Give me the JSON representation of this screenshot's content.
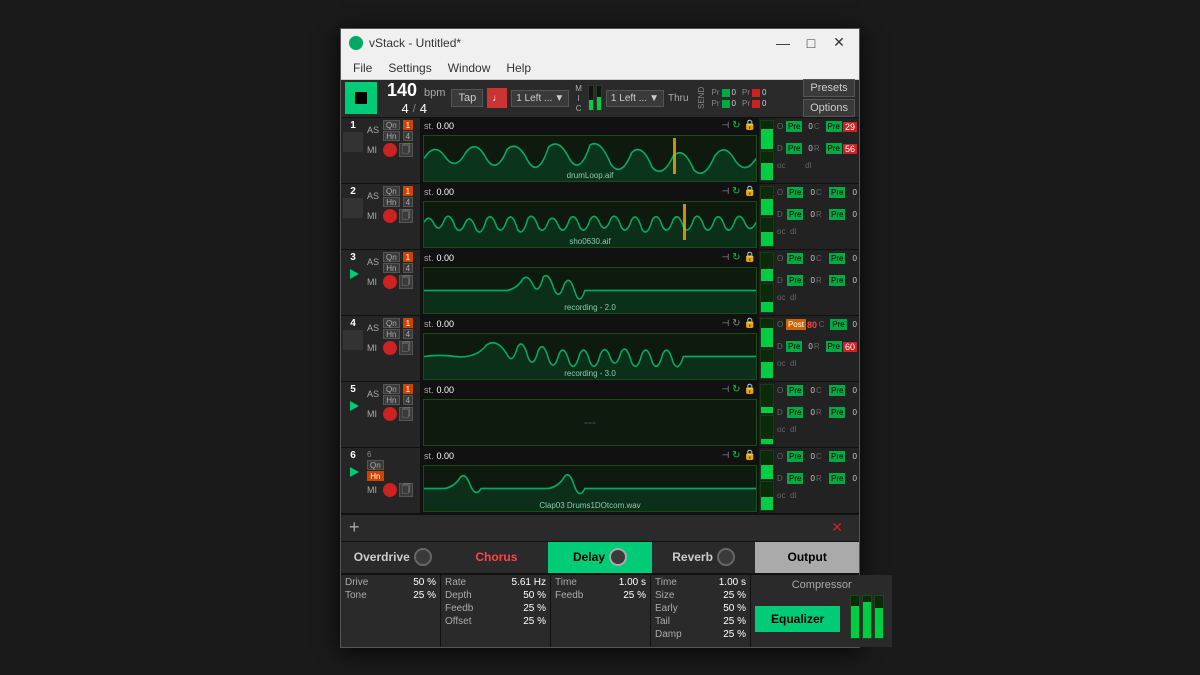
{
  "window": {
    "title": "vStack - Untitled*",
    "icon_color": "#00aa66"
  },
  "menu": {
    "items": [
      "File",
      "Settings",
      "Window",
      "Help"
    ]
  },
  "transport": {
    "bpm": "140",
    "bpm_label": "bpm",
    "time_sig_top": "4",
    "time_sig_bot": "4",
    "tap_label": "Tap",
    "input_left": "1 Left ...",
    "input_right": "1 Left ...",
    "mic_label": "M\nI\nC",
    "thru_label": "Thru",
    "presets_label": "Presets",
    "options_label": "Options",
    "ch_rows": [
      {
        "label": "Pr",
        "val": "0",
        "label2": "Pr",
        "val2": "0"
      },
      {
        "label": "Pr",
        "val": "0",
        "label2": "Pr",
        "val2": "0"
      }
    ]
  },
  "tracks": [
    {
      "num": "1",
      "playing": false,
      "file": "drumLoop.aif",
      "pos": "0.00",
      "qhn_active": "1",
      "meter_height1": "70",
      "meter_height2": "60",
      "sends": {
        "o": "O",
        "d": "D",
        "oc": "oc",
        "dl": "dl",
        "pre_o": "Pre",
        "val_o": "0",
        "pre_c": "Pre",
        "val_c_red": "29",
        "pre_d": "Pre",
        "val_d": "0",
        "pre_r": "Pre",
        "val_r_red": "56"
      },
      "waveform_color": "#00cc77"
    },
    {
      "num": "2",
      "playing": false,
      "file": "sho0630.aif",
      "pos": "0.00",
      "qhn_active": "1",
      "meter_height1": "55",
      "meter_height2": "50",
      "sends": {
        "pre_o": "Pre",
        "val_o": "0",
        "pre_c": "Pre",
        "val_c": "0",
        "pre_d": "Pre",
        "val_d": "0",
        "pre_r": "Pre",
        "val_r": "0"
      },
      "waveform_color": "#00cc77"
    },
    {
      "num": "3",
      "playing": true,
      "file": "recording - 2.0",
      "pos": "0.00",
      "qhn_active": "1",
      "meter_height1": "40",
      "meter_height2": "35",
      "sends": {
        "pre_o": "Pre",
        "val_o": "0",
        "pre_c": "Pre",
        "val_c": "0",
        "pre_d": "Pre",
        "val_d": "0",
        "pre_r": "Pre",
        "val_r": "0"
      },
      "waveform_color": "#00cc77"
    },
    {
      "num": "4",
      "playing": false,
      "file": "recording - 3.0",
      "pos": "0.00",
      "qhn_active": "1",
      "meter_height1": "65",
      "meter_height2": "55",
      "sends": {
        "pre_o": "Post",
        "val_o": "80",
        "pre_c": "Pre",
        "val_c": "0",
        "pre_d": "Pre",
        "val_d": "0",
        "pre_r": "Pre",
        "val_r_red": "60"
      },
      "waveform_color": "#00cc77"
    },
    {
      "num": "5",
      "playing": true,
      "file": "---",
      "pos": "0.00",
      "qhn_active": "1",
      "meter_height1": "30",
      "meter_height2": "25",
      "sends": {
        "pre_o": "Pre",
        "val_o": "0",
        "pre_c": "Pre",
        "val_c": "0",
        "pre_d": "Pre",
        "val_d": "0",
        "pre_r": "Pre",
        "val_r": "0"
      },
      "waveform_color": "#00cc77"
    },
    {
      "num": "6",
      "playing": true,
      "file": "Clap03 Drums1DOtcom.wav",
      "pos": "0.00",
      "qhn_active": "1",
      "meter_height1": "50",
      "meter_height2": "45",
      "sends": {
        "pre_o": "Pre",
        "val_o": "0",
        "pre_c": "Pre",
        "val_c": "0",
        "pre_d": "Pre",
        "val_d": "0",
        "pre_r": "Pre",
        "val_r": "0"
      },
      "waveform_color": "#00cc77"
    }
  ],
  "effects": {
    "overdrive": {
      "label": "Overdrive",
      "params": [
        {
          "name": "Drive",
          "value": "50 %"
        },
        {
          "name": "Tone",
          "value": "25 %"
        }
      ]
    },
    "chorus": {
      "label": "Chorus",
      "params": [
        {
          "name": "Rate",
          "value": "5.61 Hz"
        },
        {
          "name": "Depth",
          "value": "50 %"
        },
        {
          "name": "Feedb",
          "value": "25 %"
        },
        {
          "name": "Offset",
          "value": "25 %"
        }
      ]
    },
    "delay": {
      "label": "Delay",
      "params": [
        {
          "name": "Time",
          "value": "1.00 s"
        },
        {
          "name": "Feedb",
          "value": "25 %"
        }
      ]
    },
    "reverb": {
      "label": "Reverb",
      "params": [
        {
          "name": "Time",
          "value": "1.00 s"
        },
        {
          "name": "Size",
          "value": "25 %"
        },
        {
          "name": "Early",
          "value": "50 %"
        },
        {
          "name": "Tail",
          "value": "25 %"
        },
        {
          "name": "Damp",
          "value": "25 %"
        }
      ]
    },
    "output": {
      "label": "Output",
      "compressor_label": "Compressor",
      "equalizer_label": "Equalizer",
      "meters": [
        {
          "height": "75"
        },
        {
          "height": "85"
        },
        {
          "height": "70"
        }
      ]
    }
  }
}
